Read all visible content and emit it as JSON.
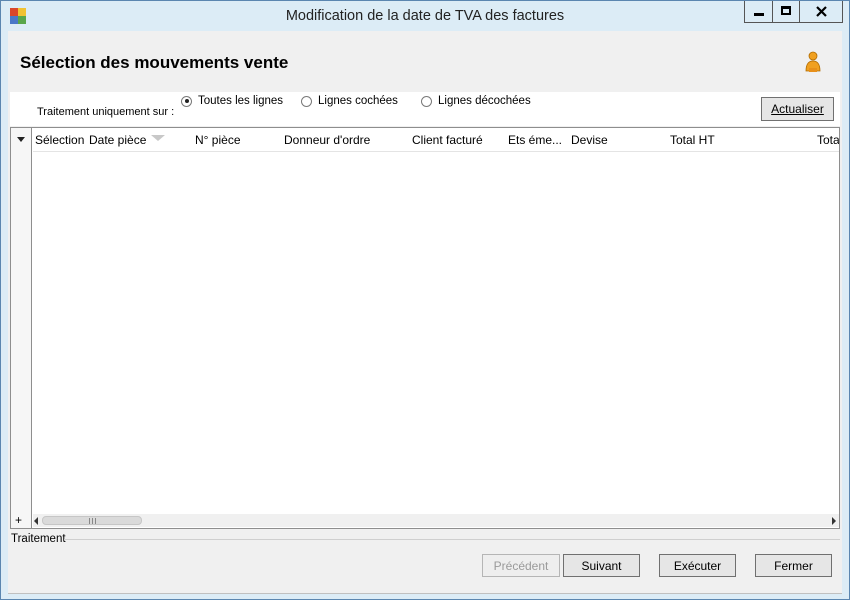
{
  "window": {
    "title": "Modification de la date de TVA des factures",
    "icons": {
      "app": "app-icon",
      "minimize": "minimize-icon",
      "maximize": "maximize-icon",
      "close": "close-icon"
    }
  },
  "header": {
    "title": "Sélection des mouvements vente",
    "user_icon": "user-icon"
  },
  "filter": {
    "label": "Traitement uniquement sur :",
    "options": [
      {
        "label": "Toutes les lignes",
        "selected": true
      },
      {
        "label": "Lignes cochées",
        "selected": false
      },
      {
        "label": "Lignes décochées",
        "selected": false
      }
    ],
    "refresh_button": "Actualiser"
  },
  "grid": {
    "columns": [
      "Sélection",
      "Date pièce",
      "N° pièce",
      "Donneur d'ordre",
      "Client facturé",
      "Ets éme...",
      "Devise",
      "Total HT",
      "Total"
    ],
    "rows": [],
    "add_row": "+"
  },
  "footer": {
    "section_label": "Traitement",
    "buttons": {
      "previous": "Précédent",
      "next": "Suivant",
      "execute": "Exécuter",
      "close": "Fermer"
    }
  },
  "colors": {
    "window_frame": "#dcecf6",
    "client_background": "#f0f0f0",
    "border": "#5b86b0",
    "person_icon": "#f0a020"
  }
}
